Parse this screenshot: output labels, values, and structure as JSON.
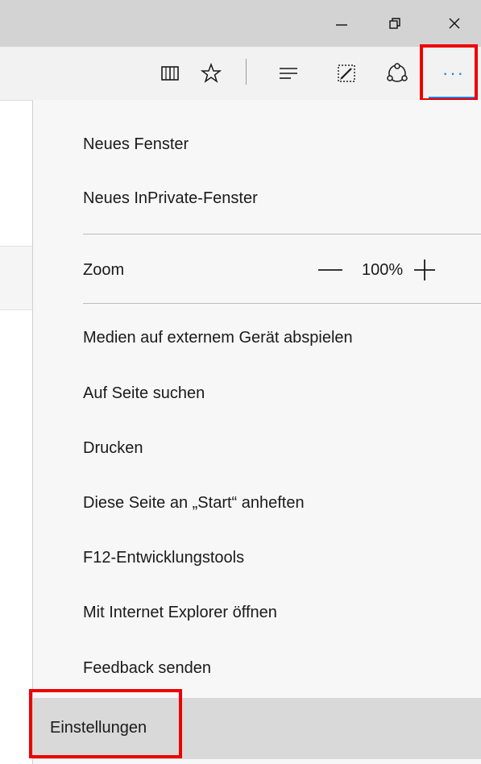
{
  "window_controls": {
    "minimize_icon": "minimize-icon",
    "restore_icon": "restore-icon",
    "close_icon": "close-icon"
  },
  "toolbar": {
    "icons": [
      "reading-view-icon",
      "favorites-star-icon",
      "hub-icon",
      "web-note-icon",
      "share-icon",
      "more-actions-icon"
    ],
    "more_label": "···",
    "accent_color": "#1e7ee6",
    "highlight_color": "#ee0000"
  },
  "menu": {
    "new_window": "Neues Fenster",
    "new_inprivate": "Neues InPrivate-Fenster",
    "zoom": {
      "label": "Zoom",
      "minus": "—",
      "value": "100%",
      "plus": "+"
    },
    "cast_media": "Medien auf externem Gerät abspielen",
    "find_on_page": "Auf Seite suchen",
    "print": "Drucken",
    "pin_start": "Diese Seite an „Start“ anheften",
    "dev_tools": "F12-Entwicklungstools",
    "open_ie": "Mit Internet Explorer öffnen",
    "feedback": "Feedback senden",
    "settings": "Einstellungen"
  }
}
